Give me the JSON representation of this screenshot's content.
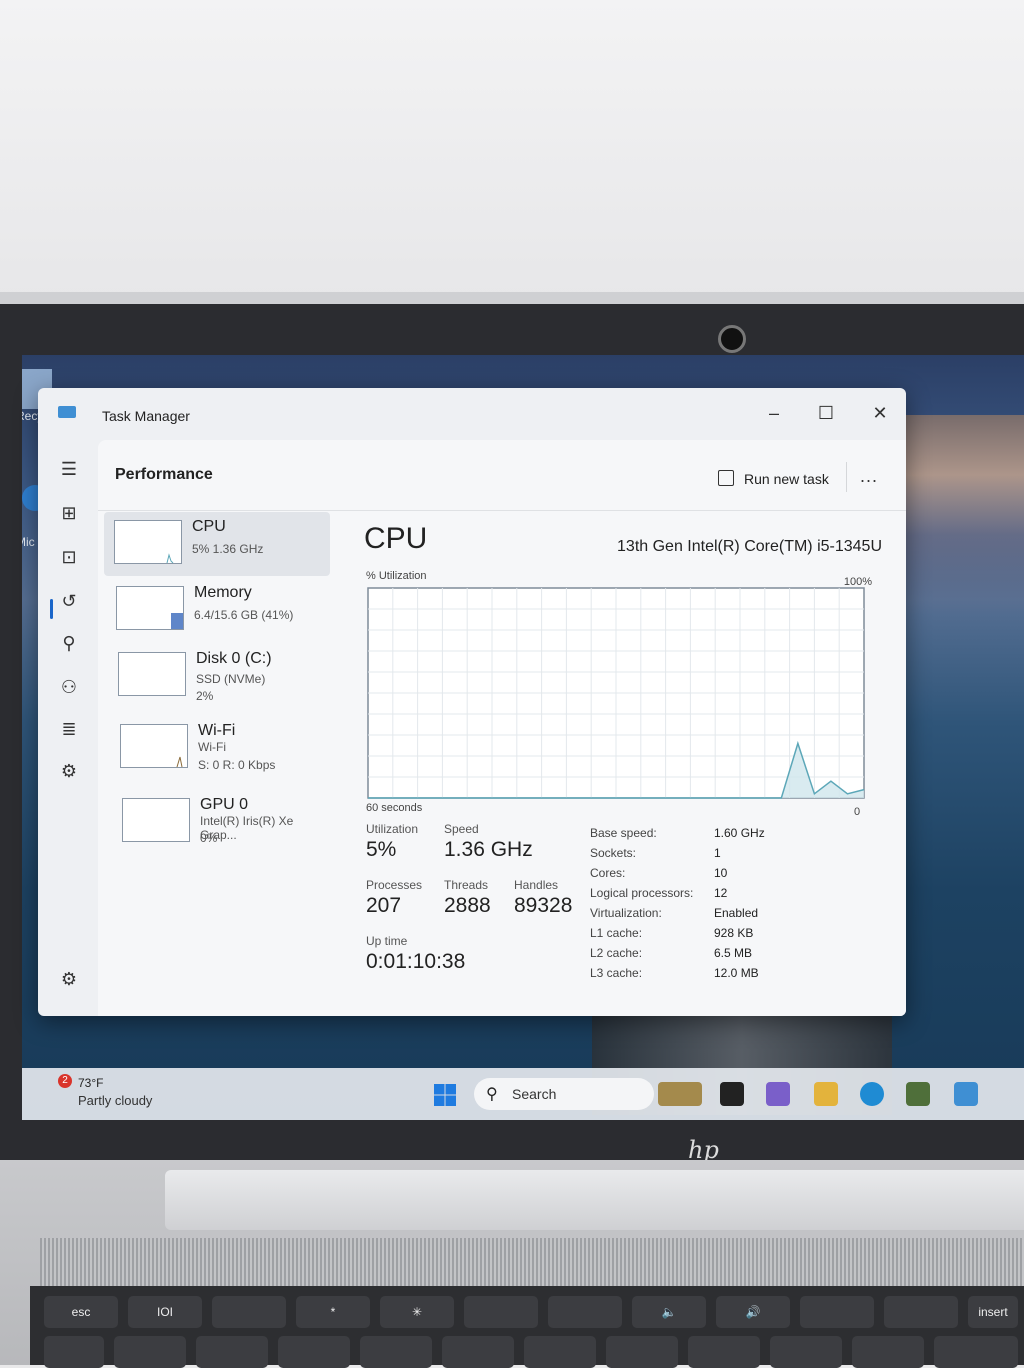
{
  "window": {
    "title": "Task Manager"
  },
  "header": {
    "page_title": "Performance",
    "run_new_task": "Run new task",
    "more": "..."
  },
  "devices": [
    {
      "name": "CPU",
      "line1": "5%  1.36 GHz",
      "line2": ""
    },
    {
      "name": "Memory",
      "line1": "6.4/15.6 GB (41%)",
      "line2": ""
    },
    {
      "name": "Disk 0 (C:)",
      "line1": "SSD (NVMe)",
      "line2": "2%"
    },
    {
      "name": "Wi-Fi",
      "line1": "Wi-Fi",
      "line2": "S: 0 R: 0 Kbps"
    },
    {
      "name": "GPU 0",
      "line1": "Intel(R) Iris(R) Xe Grap...",
      "line2": "0%"
    }
  ],
  "detail": {
    "title": "CPU",
    "model": "13th Gen Intel(R) Core(TM) i5-1345U",
    "utilization_label": "% Utilization",
    "max_label": "100%",
    "time_label": "60 seconds",
    "min_label": "0",
    "stats": {
      "utilization_label": "Utilization",
      "utilization": "5%",
      "speed_label": "Speed",
      "speed": "1.36 GHz",
      "processes_label": "Processes",
      "processes": "207",
      "threads_label": "Threads",
      "threads": "2888",
      "handles_label": "Handles",
      "handles": "89328",
      "uptime_label": "Up time",
      "uptime": "0:01:10:38"
    },
    "specs": [
      {
        "k": "Base speed:",
        "v": "1.60 GHz"
      },
      {
        "k": "Sockets:",
        "v": "1"
      },
      {
        "k": "Cores:",
        "v": "10"
      },
      {
        "k": "Logical processors:",
        "v": "12"
      },
      {
        "k": "Virtualization:",
        "v": "Enabled"
      },
      {
        "k": "L1 cache:",
        "v": "928 KB"
      },
      {
        "k": "L2 cache:",
        "v": "6.5 MB"
      },
      {
        "k": "L3 cache:",
        "v": "12.0 MB"
      }
    ]
  },
  "chart_data": {
    "type": "area",
    "ylim": [
      0,
      100
    ],
    "x": [
      0,
      2,
      4,
      6,
      8,
      10,
      12,
      14,
      16,
      18,
      20,
      22,
      24,
      26,
      28,
      30,
      32,
      34,
      36,
      38,
      40,
      42,
      44,
      46,
      48,
      50,
      52,
      54,
      56,
      58,
      60
    ],
    "values": [
      0,
      0,
      0,
      0,
      0,
      0,
      0,
      0,
      0,
      0,
      0,
      0,
      0,
      0,
      0,
      0,
      0,
      0,
      0,
      0,
      0,
      0,
      0,
      0,
      0,
      0,
      26,
      2,
      8,
      2,
      4
    ]
  },
  "taskbar": {
    "badge": "2",
    "temperature": "73°F",
    "condition": "Partly cloudy",
    "search": "Search"
  },
  "desktop": {
    "recycle_label": "Recy",
    "edge_label": "Mic E"
  },
  "keyboard": [
    "esc",
    "IOI",
    "",
    "*",
    "✳",
    "",
    "",
    "🔈",
    "🔊",
    "",
    "",
    "insert"
  ],
  "brand": "hp",
  "colors": {
    "graph_line": "#5ca7b8",
    "graph_fill": "#cfe6ec",
    "accent": "#1a66c9"
  }
}
